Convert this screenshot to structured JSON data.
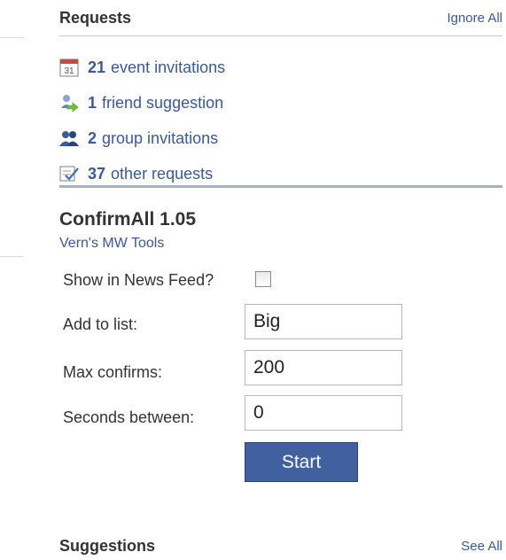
{
  "requests": {
    "title": "Requests",
    "ignore_all": "Ignore All",
    "items": [
      {
        "count": "21",
        "text": "event invitations",
        "icon": "calendar-icon",
        "calendar_day": "31"
      },
      {
        "count": "1",
        "text": "friend suggestion",
        "icon": "friend-suggestion-icon"
      },
      {
        "count": "2",
        "text": "group invitations",
        "icon": "group-icon"
      },
      {
        "count": "37",
        "text": "other requests",
        "icon": "request-checklist-icon"
      }
    ]
  },
  "app": {
    "title": "ConfirmAll 1.05",
    "subtitle": "Vern's MW Tools",
    "show_news_feed_label": "Show in News Feed?",
    "show_news_feed_checked": false,
    "add_to_list_label": "Add to list:",
    "add_to_list_value": "Big",
    "max_confirms_label": "Max confirms:",
    "max_confirms_value": "200",
    "seconds_between_label": "Seconds between:",
    "seconds_between_value": "0",
    "start_label": "Start"
  },
  "suggestions": {
    "title": "Suggestions",
    "see_all": "See All"
  },
  "colors": {
    "link": "#3b5998",
    "heading": "#333333",
    "button": "#4060a0",
    "divider": "#a6b0c8"
  }
}
